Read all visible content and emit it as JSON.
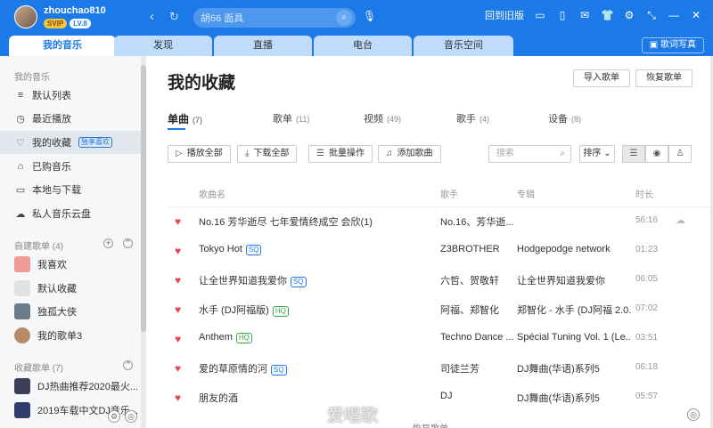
{
  "user": {
    "name": "zhouchao810",
    "badge_svip": "SVIP",
    "badge_level": "LV.8"
  },
  "nav": {
    "back": "‹",
    "refresh": "↻"
  },
  "search": {
    "placeholder": "胡66 面具",
    "icon": "search-icon"
  },
  "top_right": {
    "back_old": "回到旧版",
    "icons": [
      "screen-icon",
      "mobile-icon",
      "mail-icon",
      "shirt-icon",
      "gear-icon",
      "shrink-icon",
      "minimize-icon",
      "close-icon"
    ]
  },
  "tabs": [
    "我的音乐",
    "发现",
    "直播",
    "电台",
    "音乐空间"
  ],
  "upload_label": "歌词写真",
  "sidebar": {
    "section_mine": "我的音乐",
    "items": [
      {
        "icon": "≡",
        "label": "默认列表"
      },
      {
        "icon": "◷",
        "label": "最近播放"
      },
      {
        "icon": "♡",
        "label": "我的收藏",
        "tag": "独享喜欢"
      },
      {
        "icon": "⌂",
        "label": "已购音乐"
      },
      {
        "icon": "▭",
        "label": "本地与下载"
      },
      {
        "icon": "☁",
        "label": "私人音乐云盘"
      }
    ],
    "section_created": "自建歌单",
    "created_count": "(4)",
    "created": [
      {
        "label": "我喜欢",
        "color": "#f19a9a"
      },
      {
        "label": "默认收藏",
        "color": "#e2e2e2"
      },
      {
        "label": "独孤大侠",
        "color": "#6a7b8a"
      },
      {
        "label": "我的歌单3",
        "color": "#b58b6a"
      }
    ],
    "section_collected": "收藏歌单",
    "collected_count": "(7)",
    "collected": [
      {
        "label": "DJ热曲推荐2020最火...",
        "color": "#3c3f56"
      },
      {
        "label": "2019车载中文DJ音乐...",
        "color": "#2e3d6b"
      }
    ]
  },
  "main": {
    "title": "我的收藏",
    "import_btn": "导入歌单",
    "restore_btn": "恢复歌单",
    "subtabs": [
      {
        "label": "单曲",
        "count": "(7)"
      },
      {
        "label": "歌单",
        "count": "(11)"
      },
      {
        "label": "视频",
        "count": "(49)"
      },
      {
        "label": "歌手",
        "count": "(4)"
      },
      {
        "label": "设备",
        "count": "(8)"
      }
    ],
    "toolbar": {
      "play_all": "播放全部",
      "download_all": "下载全部",
      "batch": "批量操作",
      "add_song": "添加歌曲",
      "search_placeholder": "搜索",
      "sort": "排序"
    },
    "columns": {
      "name": "歌曲名",
      "artist": "歌手",
      "album": "专辑",
      "duration": "时长"
    },
    "songs": [
      {
        "name": "No.16 芳华逝尽 七年爱情终成空 会欣(1)",
        "quality": "",
        "artist": "No.16、芳华逝...",
        "album": "",
        "duration": "56:16"
      },
      {
        "name": "Tokyo Hot",
        "quality": "SQ",
        "artist": "Z3BROTHER",
        "album": "Hodgepodge network",
        "duration": "01:23"
      },
      {
        "name": "让全世界知道我爱你",
        "quality": "SQ",
        "artist": "六哲、贺敬轩",
        "album": "让全世界知道我爱你",
        "duration": "06:05"
      },
      {
        "name": "水手 (DJ阿福版)",
        "quality": "HQ",
        "artist": "阿福、郑智化",
        "album": "郑智化 - 水手 (DJ阿福 2.0...",
        "duration": "07:02"
      },
      {
        "name": "Anthem",
        "quality": "HQ",
        "artist": "Techno Dance ...",
        "album": "Spécial Tuning Vol. 1 (Le...",
        "duration": "03:51"
      },
      {
        "name": "爱的草原情的河",
        "quality": "SQ",
        "artist": "司徒兰芳",
        "album": "DJ舞曲(华语)系列5",
        "duration": "06:18"
      },
      {
        "name": "朋友的酒",
        "quality": "",
        "artist": "DJ",
        "album": "DJ舞曲(华语)系列5",
        "duration": "05:57"
      }
    ],
    "restore_more": "恢复歌单",
    "watermark": "爱唱歌"
  }
}
